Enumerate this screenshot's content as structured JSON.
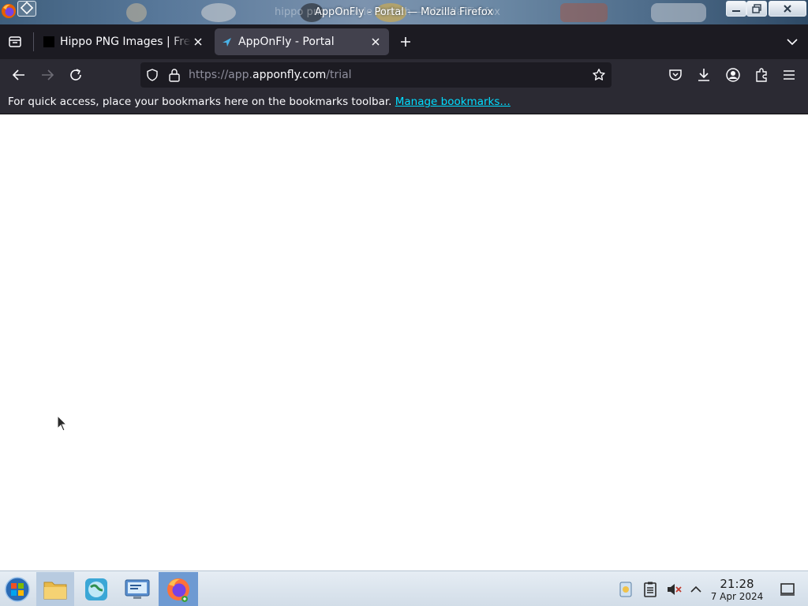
{
  "window": {
    "title": "AppOnFly - Portal — Mozilla Firefox",
    "ghost_title": "hippo png - Google Search — Mozilla Firefox"
  },
  "tabs": [
    {
      "label": "Hippo PNG Images | Free",
      "active": false,
      "icon": "black-square-favicon-icon"
    },
    {
      "label": "AppOnFly - Portal",
      "active": true,
      "icon": "apponfly-arrow-favicon-icon"
    }
  ],
  "nav": {
    "url_prefix": "https://app.",
    "url_host": "apponfly.com",
    "url_path": "/trial"
  },
  "bookmarks_bar": {
    "message": "For quick access, place your bookmarks here on the bookmarks toolbar. ",
    "manage_link": "Manage bookmarks…"
  },
  "taskbar": {
    "apps": [
      {
        "name": "start-menu",
        "icon": "windows-orb-icon"
      },
      {
        "name": "file-manager",
        "icon": "folder-icon"
      },
      {
        "name": "browser-globe",
        "icon": "globe-icon"
      },
      {
        "name": "control-panel",
        "icon": "monitor-settings-icon"
      },
      {
        "name": "firefox",
        "icon": "firefox-icon"
      }
    ],
    "clock": {
      "time": "21:28",
      "date": "7 Apr 2024"
    }
  },
  "colors": {
    "tabstrip_bg": "#1c1b22",
    "toolbar_bg": "#2b2a33",
    "link": "#00ddff",
    "active_tab": "#42414d"
  }
}
